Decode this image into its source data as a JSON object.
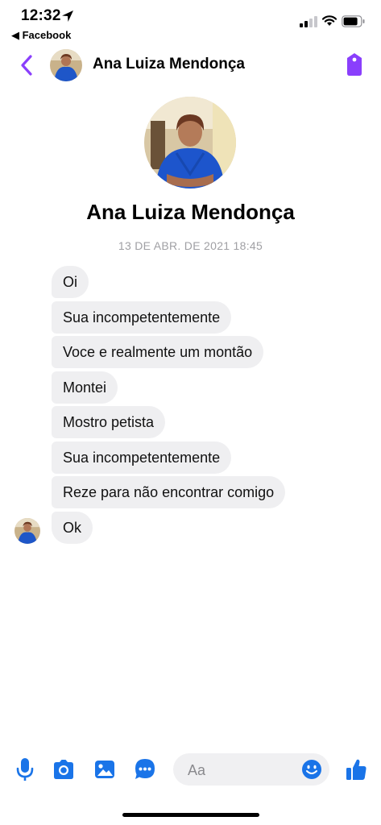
{
  "status_bar": {
    "time": "12:32",
    "back_app": "◀ Facebook"
  },
  "header": {
    "contact_name": "Ana Luiza Mendonça"
  },
  "profile": {
    "name": "Ana Luiza Mendonça",
    "timestamp": "13 DE ABR. DE 2021 18:45"
  },
  "messages": [
    {
      "text": "Oi"
    },
    {
      "text": "Sua incompetentemente"
    },
    {
      "text": "Voce e realmente um montão"
    },
    {
      "text": "Montei"
    },
    {
      "text": "Mostro petista"
    },
    {
      "text": "Sua incompetentemente"
    },
    {
      "text": "Reze para não encontrar comigo"
    },
    {
      "text": "Ok"
    }
  ],
  "composer": {
    "placeholder": "Aa"
  },
  "colors": {
    "accent": "#8a3ffc",
    "blue": "#1a74e8",
    "bubble": "#efeff1",
    "timestamp": "#a0a0a4"
  },
  "icons": [
    "location-arrow-icon",
    "signal-icon",
    "wifi-icon",
    "battery-icon",
    "back-chevron-icon",
    "tag-icon",
    "microphone-icon",
    "camera-icon",
    "gallery-icon",
    "sticker-icon",
    "emoji-icon",
    "thumbs-up-icon"
  ]
}
